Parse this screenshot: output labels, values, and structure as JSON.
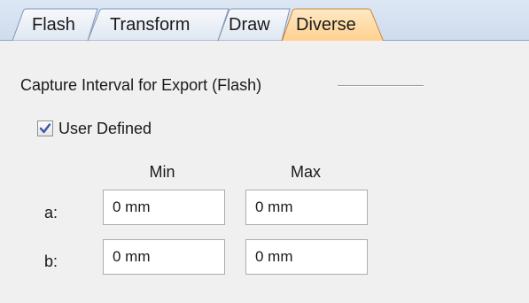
{
  "tabs": [
    {
      "label": "Flash",
      "active": false
    },
    {
      "label": "Transform",
      "active": false
    },
    {
      "label": "Draw",
      "active": false
    },
    {
      "label": "Diverse",
      "active": true
    }
  ],
  "group": {
    "title": "Capture Interval for Export (Flash)"
  },
  "user_defined": {
    "label": "User Defined",
    "checked": true
  },
  "columns": {
    "min": "Min",
    "max": "Max"
  },
  "rows": [
    {
      "label": "a:",
      "min": "0 mm",
      "max": "0 mm"
    },
    {
      "label": "b:",
      "min": "0 mm",
      "max": "0 mm"
    }
  ],
  "colors": {
    "active_tab": "#ffd9a3",
    "tab_strip": "#d6e1f0",
    "panel": "#f0f0f0",
    "check_mark": "#3a57a8"
  }
}
